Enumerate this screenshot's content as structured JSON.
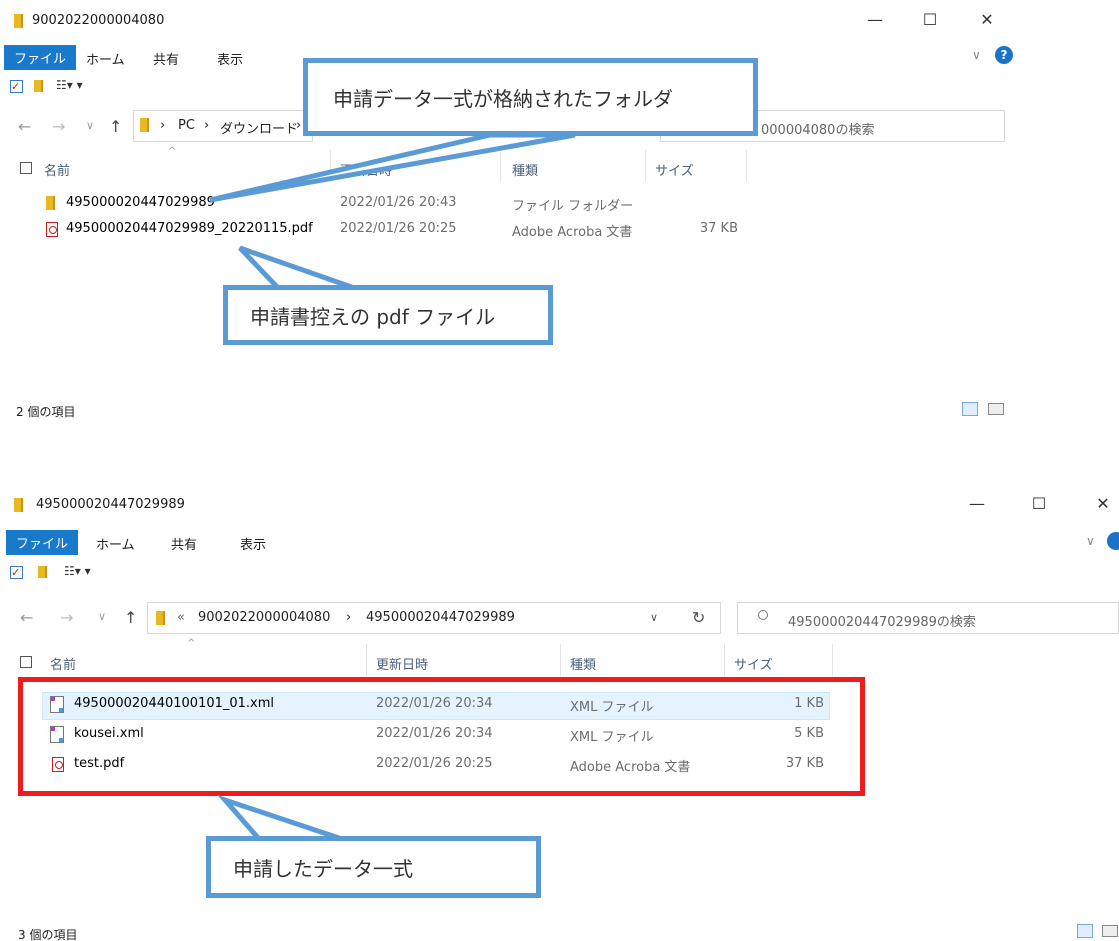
{
  "window1": {
    "title": "9002022000004080",
    "controls": {
      "minimize": "—",
      "maximize": "☐",
      "close": "✕"
    },
    "ribbon": {
      "file": "ファイル",
      "home": "ホーム",
      "share": "共有",
      "view": "表示"
    },
    "help_icon": "?",
    "address": {
      "pc": "PC",
      "downloads": "ダウンロード",
      "sep": "›"
    },
    "search_placeholder": "000004080の検索",
    "columns": {
      "name": "名前",
      "modified": "更新日時",
      "type": "種類",
      "size": "サイズ"
    },
    "rows": [
      {
        "name": "495000020447029989",
        "modified": "2022/01/26 20:43",
        "type": "ファイル フォルダー",
        "size": ""
      },
      {
        "name": "495000020447029989_20220115.pdf",
        "modified": "2022/01/26 20:25",
        "type": "Adobe Acroba 文書",
        "size": "37 KB"
      }
    ],
    "status": "2 個の項目"
  },
  "window2": {
    "title": "495000020447029989",
    "controls": {
      "minimize": "—",
      "maximize": "☐",
      "close": "✕"
    },
    "ribbon": {
      "file": "ファイル",
      "home": "ホーム",
      "share": "共有",
      "view": "表示"
    },
    "address": {
      "overflow": "«",
      "folder1": "9002022000004080",
      "sep": "›",
      "folder2": "495000020447029989"
    },
    "search_placeholder": "495000020447029989の検索",
    "columns": {
      "name": "名前",
      "modified": "更新日時",
      "type": "種類",
      "size": "サイズ"
    },
    "rows": [
      {
        "name": "495000020440100101_01.xml",
        "modified": "2022/01/26 20:34",
        "type": "XML ファイル",
        "size": "1 KB"
      },
      {
        "name": "kousei.xml",
        "modified": "2022/01/26 20:34",
        "type": "XML ファイル",
        "size": "5 KB"
      },
      {
        "name": "test.pdf",
        "modified": "2022/01/26 20:25",
        "type": "Adobe Acroba 文書",
        "size": "37 KB"
      }
    ],
    "status": "3 個の項目"
  },
  "callouts": {
    "folder": "申請データ一式が格納されたフォルダ",
    "pdf": "申請書控えの pdf ファイル",
    "data": "申請したデータ一式"
  },
  "colors": {
    "callout_border": "#5b9bd5",
    "highlight_border": "#ee1c1c",
    "ribbon_file": "#1979ca"
  },
  "icons": [
    "folder-icon",
    "pdf-icon",
    "xml-icon",
    "back-arrow-icon",
    "forward-arrow-icon",
    "up-arrow-icon",
    "refresh-icon",
    "search-icon",
    "help-icon",
    "details-view-icon",
    "large-icons-view-icon"
  ]
}
